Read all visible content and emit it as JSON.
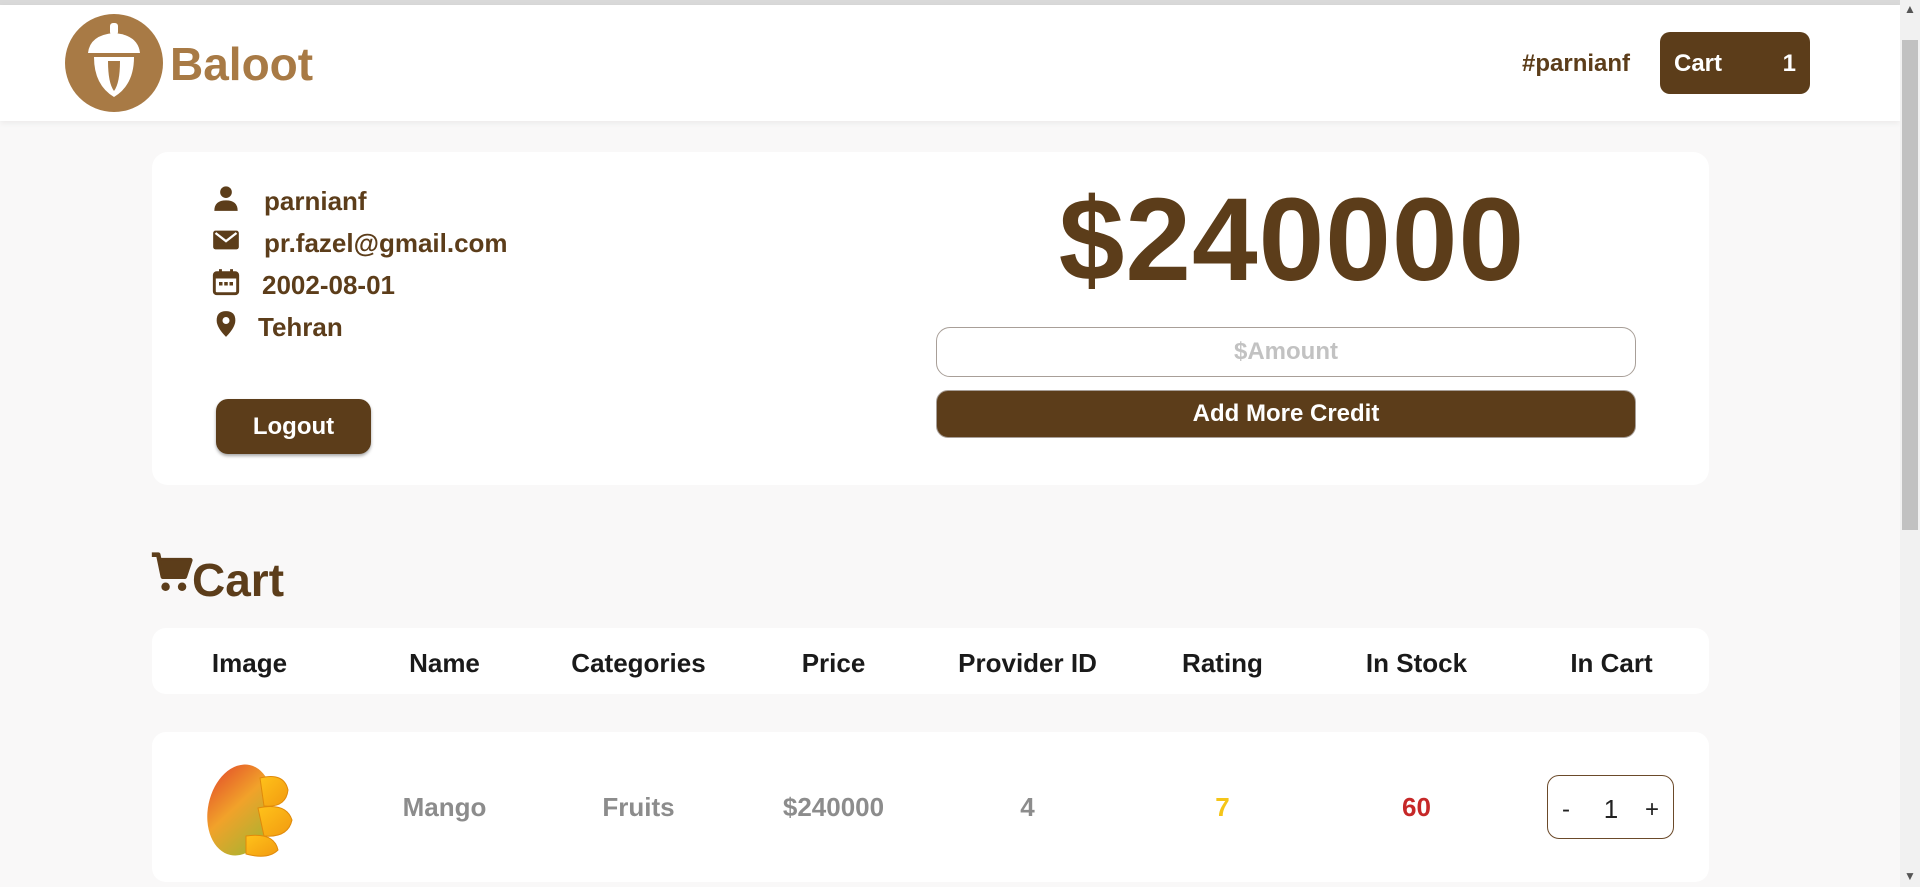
{
  "colors": {
    "brand_brown": "#5c3d1a",
    "logo_tan": "#a87a45",
    "rating_yellow": "#f5c518",
    "stock_red": "#c62828",
    "muted_gray": "#8c8c8c"
  },
  "header": {
    "brand": "Baloot",
    "username_tag": "#parnianf",
    "cart_label": "Cart",
    "cart_count": "1"
  },
  "profile": {
    "username": "parnianf",
    "email": "pr.fazel@gmail.com",
    "birth_date": "2002-08-01",
    "address": "Tehran",
    "logout_label": "Logout",
    "icons": [
      "person-icon",
      "mail-icon",
      "calendar-icon",
      "location-pin-icon"
    ]
  },
  "credit": {
    "amount": "$240000",
    "input_placeholder": "$Amount",
    "add_button_label": "Add More Credit"
  },
  "cart": {
    "title": "Cart",
    "columns": [
      "Image",
      "Name",
      "Categories",
      "Price",
      "Provider ID",
      "Rating",
      "In Stock",
      "In Cart"
    ],
    "rows": [
      {
        "image_icon": "mango-image",
        "name": "Mango",
        "categories": "Fruits",
        "price": "$240000",
        "provider_id": "4",
        "rating": "7",
        "in_stock": "60",
        "in_cart": "1",
        "minus_label": "-",
        "plus_label": "+"
      }
    ]
  }
}
